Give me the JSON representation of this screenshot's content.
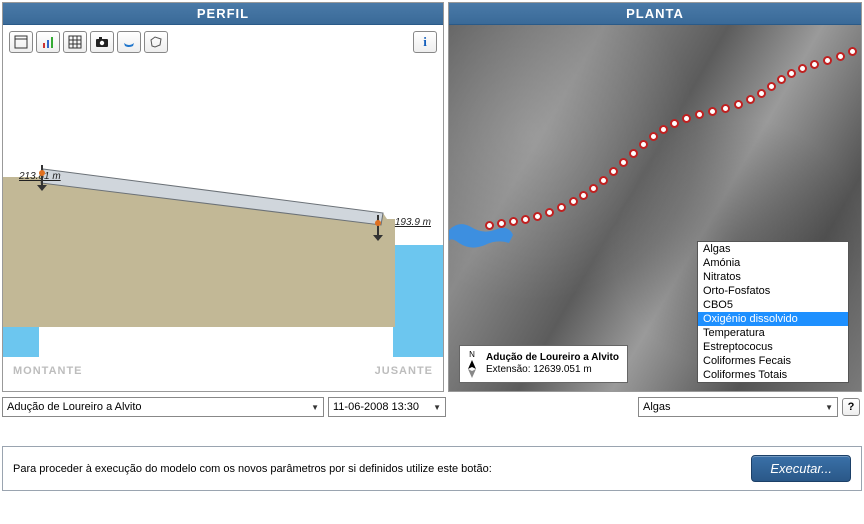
{
  "panels": {
    "left_title": "PERFIL",
    "right_title": "PLANTA"
  },
  "toolbar_icons": [
    "window-icon",
    "bar-chart-icon",
    "grid-icon",
    "camera-icon",
    "boat-icon",
    "polygon-icon",
    "info-icon"
  ],
  "profile": {
    "left_elev": "213.81 m",
    "right_elev": "193.9 m",
    "label_upstream": "MONTANTE",
    "label_downstream": "JUSANTE"
  },
  "map_info": {
    "title": "Adução de Loureiro a Alvito",
    "extent_label": "Extensão:",
    "extent_value": "12639.051 m",
    "compass": "N"
  },
  "param_list": {
    "items": [
      "Algas",
      "Amónia",
      "Nitratos",
      "Orto-Fosfatos",
      "CBO5",
      "Oxigénio dissolvido",
      "Temperatura",
      "Estreptococus",
      "Coliformes Fecais",
      "Coliformes Totais"
    ],
    "selected_index": 5
  },
  "selectors": {
    "pipeline": "Adução de Loureiro a Alvito",
    "datetime": "11-06-2008 13:30",
    "parameter": "Algas"
  },
  "footer": {
    "text": "Para proceder à execução do modelo com os novos parâmetros por si definidos utilize este botão:",
    "button": "Executar..."
  }
}
